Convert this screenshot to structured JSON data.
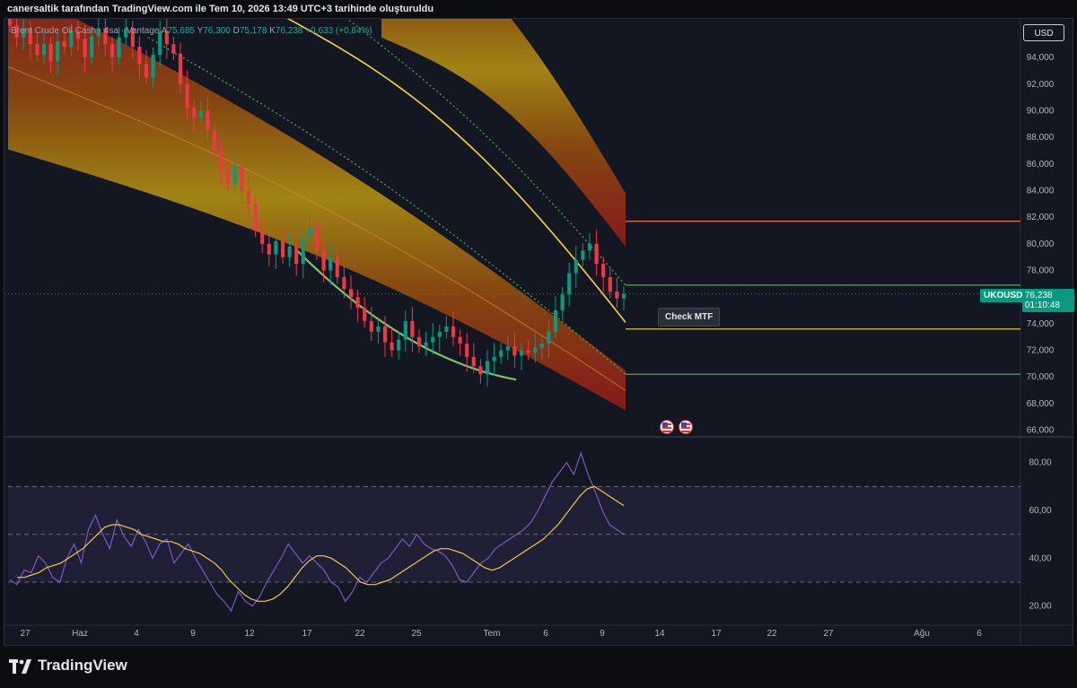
{
  "header": {
    "caption": "canersaltik tarafından TradingView.com ile Tem 10, 2026 13:49 UTC+3 tarihinde oluşturuldu"
  },
  "legend": {
    "title": "Brent Crude Oil Cash · 4sa · Vantage",
    "open_label": "A",
    "open_value": "75,685",
    "high_label": "Y",
    "high_value": "76,300",
    "low_label": "D",
    "low_value": "75,178",
    "close_label": "K",
    "close_value": "76,238",
    "change": "+0,633 (+0,84%)"
  },
  "currency_button": "USD",
  "price_tag": {
    "symbol": "UKOUSD",
    "price": "76,238",
    "countdown": "01:10:48"
  },
  "mtf_label": "Check MTF",
  "flags": [
    "us-flag-icon",
    "us-flag-icon"
  ],
  "brand": {
    "name": "TradingView"
  },
  "colors": {
    "background": "#131722",
    "up": "#089981",
    "down": "#f23645",
    "yellow_line": "#ffd23c",
    "green_line": "#4caf50",
    "rsi_line": "#7e57c2",
    "rsi_ma": "#f5c842",
    "band_gold": "#a88a14",
    "band_red": "#8b1a1a"
  },
  "chart_data": [
    {
      "type": "line",
      "name": "price",
      "x_ticks": [
        "27",
        "Haz",
        "4",
        "9",
        "12",
        "17",
        "22",
        "25",
        "Tem",
        "6",
        "9",
        "14",
        "17",
        "22",
        "27",
        "Ağu",
        "6"
      ],
      "y_ticks": [
        "94,000",
        "92,000",
        "90,000",
        "88,000",
        "86,000",
        "84,000",
        "82,000",
        "80,000",
        "78,000",
        "76,000",
        "74,000",
        "72,000",
        "70,000",
        "68,000",
        "66,000"
      ],
      "ylim": [
        65.5,
        96.5
      ],
      "close": [
        96.4,
        95.5,
        96.2,
        95.0,
        94.2,
        95.0,
        93.7,
        95.2,
        94.8,
        96.0,
        95.4,
        94.0,
        95.6,
        96.2,
        95.0,
        94.0,
        95.5,
        96.2,
        94.8,
        93.5,
        92.5,
        94.2,
        96.0,
        95.0,
        94.3,
        92.0,
        90.2,
        89.5,
        90.0,
        88.5,
        87.0,
        85.5,
        84.5,
        85.8,
        84.0,
        83.0,
        81.0,
        80.0,
        79.2,
        80.2,
        79.0,
        79.8,
        78.5,
        80.5,
        81.2,
        79.5,
        78.0,
        79.0,
        77.5,
        76.6,
        76.0,
        75.2,
        74.2,
        73.4,
        73.8,
        72.6,
        72.0,
        72.8,
        74.2,
        73.0,
        72.3,
        72.6,
        73.0,
        73.4,
        73.8,
        73.0,
        72.5,
        71.5,
        70.8,
        70.2,
        71.2,
        71.5,
        72.0,
        72.3,
        71.6,
        72.0,
        71.8,
        72.2,
        72.5,
        73.4,
        75.0,
        76.2,
        77.8,
        78.8,
        79.5,
        80.0,
        78.5,
        77.5,
        76.4,
        75.9,
        76.238
      ],
      "levels": {
        "upper_band_top_end": 83.9,
        "upper_band_bottom_end": 79.8,
        "lower_band_top_end": 67.5,
        "lower_band_bottom_end": 65.6,
        "red_line": 81.7,
        "green_upper_line": 76.9,
        "yellow_line": 73.6,
        "green_lower_line": 70.2
      }
    },
    {
      "type": "line",
      "name": "oscillator",
      "y_ticks": [
        "80,00",
        "60,00",
        "40,00",
        "20,00"
      ],
      "ylim": [
        12,
        90
      ],
      "upper_band": 70,
      "mid_line": 50,
      "lower_band": 30,
      "values": [
        31,
        29,
        35,
        34,
        41,
        38,
        32,
        30,
        40,
        46,
        38,
        52,
        58,
        50,
        44,
        56,
        49,
        45,
        52,
        47,
        40,
        46,
        48,
        38,
        42,
        46,
        40,
        35,
        30,
        25,
        22,
        18,
        26,
        22,
        20,
        24,
        30,
        35,
        40,
        46,
        42,
        38,
        41,
        38,
        35,
        30,
        28,
        22,
        26,
        32,
        30,
        34,
        38,
        40,
        44,
        48,
        45,
        50,
        46,
        44,
        43,
        41,
        37,
        31,
        30,
        34,
        38,
        40,
        44,
        46,
        48,
        50,
        52,
        55,
        60,
        66,
        72,
        76,
        80,
        75,
        84,
        75,
        68,
        60,
        54,
        52,
        50
      ],
      "ma": [
        32,
        32,
        33,
        34,
        36,
        37,
        38,
        40,
        42,
        44,
        47,
        50,
        53,
        54,
        54,
        53,
        52,
        50,
        49,
        48,
        47,
        47,
        46,
        44,
        43,
        42,
        40,
        38,
        35,
        31,
        28,
        25,
        23,
        22,
        22,
        23,
        25,
        28,
        32,
        36,
        39,
        41,
        41,
        40,
        38,
        36,
        33,
        30,
        29,
        29,
        30,
        31,
        33,
        35,
        37,
        39,
        41,
        43,
        44,
        44,
        43,
        42,
        40,
        38,
        36,
        35,
        36,
        38,
        40,
        42,
        44,
        46,
        48,
        51,
        54,
        58,
        62,
        66,
        69,
        70,
        68,
        66,
        64,
        62
      ]
    }
  ]
}
